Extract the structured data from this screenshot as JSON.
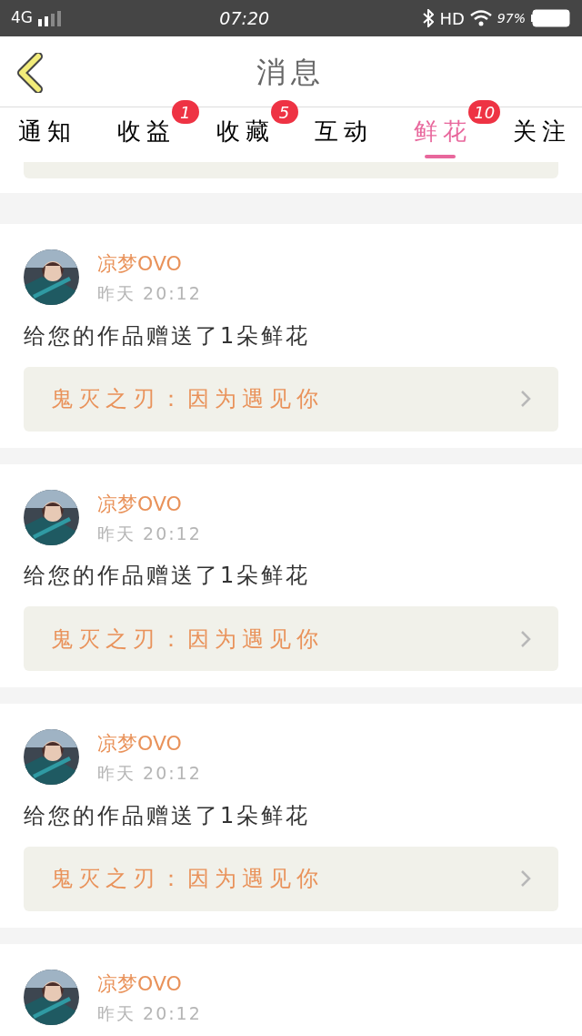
{
  "status_bar": {
    "network": "4G",
    "time": "07:20",
    "hd": "HD",
    "battery": "97%"
  },
  "header": {
    "title": "消息"
  },
  "tabs": [
    {
      "label": "通知",
      "selected": false
    },
    {
      "label": "收益",
      "selected": false,
      "badge": "1"
    },
    {
      "label": "收藏",
      "selected": false,
      "badge": "5"
    },
    {
      "label": "互动",
      "selected": false
    },
    {
      "label": "鲜花",
      "selected": true,
      "badge": "10"
    },
    {
      "label": "关注",
      "selected": false
    }
  ],
  "messages": [
    {
      "name": "凉梦OVO",
      "time": "昨天 20:12",
      "text": "给您的作品赠送了1朵鲜花",
      "work": "鬼灭之刃：因为遇见你"
    },
    {
      "name": "凉梦OVO",
      "time": "昨天 20:12",
      "text": "给您的作品赠送了1朵鲜花",
      "work": "鬼灭之刃：因为遇见你"
    },
    {
      "name": "凉梦OVO",
      "time": "昨天 20:12",
      "text": "给您的作品赠送了1朵鲜花",
      "work": "鬼灭之刃：因为遇见你"
    },
    {
      "name": "凉梦OVO",
      "time": "昨天 20:12"
    }
  ]
}
